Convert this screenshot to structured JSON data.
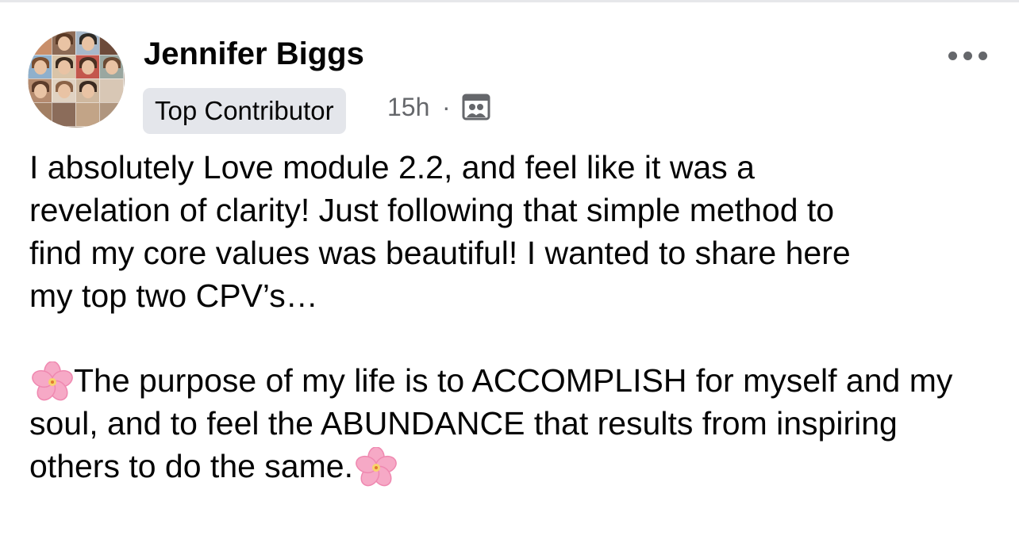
{
  "post": {
    "author": {
      "name": "Jennifer Biggs",
      "badge": "Top Contributor"
    },
    "meta": {
      "time": "15h",
      "separator": "·",
      "audience_icon": "group-members-icon"
    },
    "more_icon": "more-options-icon",
    "body": {
      "paragraph_1": "I absolutely Love module 2.2, and feel like it was a\nrevelation of clarity! Just following that simple method to\nfind my core values was beautiful! I wanted to share here\nmy top two CPV’s…",
      "paragraph_2_text": "The purpose of my life is to ACCOMPLISH for myself and my soul, and to feel the ABUNDANCE that results from inspiring others to do the same.",
      "emoji": "cherry-blossom-icon"
    }
  },
  "colors": {
    "text": "#050505",
    "secondary": "#65676b",
    "badge_bg": "#e4e6eb",
    "blossom": "#f6a9c6"
  }
}
